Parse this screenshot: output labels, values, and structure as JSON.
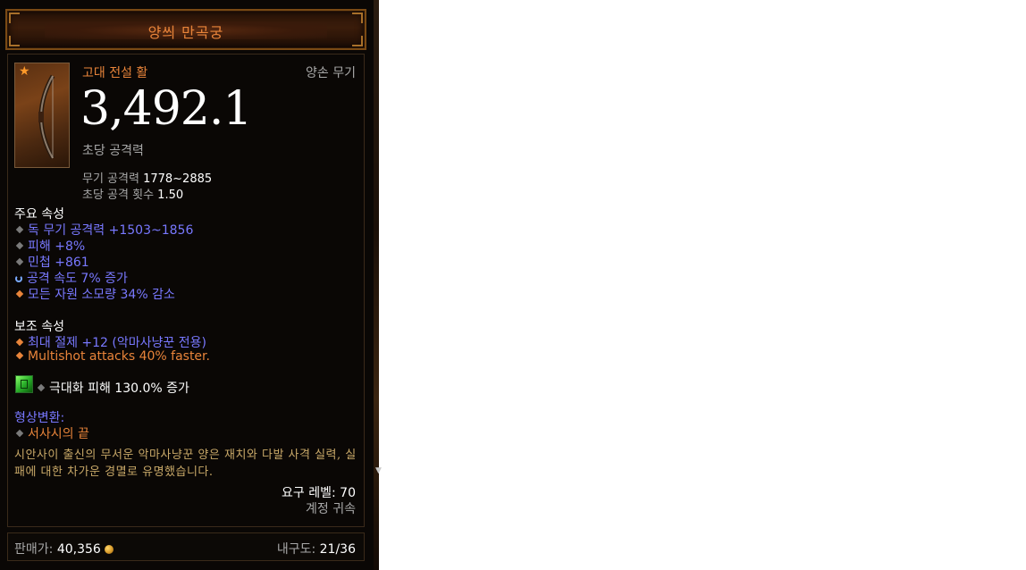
{
  "item": {
    "name": "양씌 만곡궁",
    "type": "고대 전설 활",
    "slot": "양손 무기",
    "dps": "3,492.1",
    "dps_label": "초당 공격력",
    "weapon_damage_label": "무기 공격력",
    "weapon_damage_value": "1778~2885",
    "attack_speed_label": "초당 공격 횟수",
    "attack_speed_value": "1.50"
  },
  "primary": {
    "title": "주요 속성",
    "attributes": [
      {
        "text": "독 무기 공격력 +1503~1856",
        "bullet": "grey"
      },
      {
        "text": "피해 +8%",
        "bullet": "grey"
      },
      {
        "text": "민첩 +861",
        "bullet": "grey"
      },
      {
        "text": "공격 속도 7% 증가",
        "bullet": "enchanted"
      },
      {
        "text": "모든 자원 소모량 34% 감소",
        "bullet": "orange"
      }
    ]
  },
  "secondary": {
    "title": "보조 속성",
    "attributes": [
      {
        "text": "최대 절제 +12 (악마사냥꾼 전용)",
        "bullet": "orange"
      },
      {
        "text": "Multishot attacks 40% faster.",
        "bullet": "orange"
      }
    ]
  },
  "socket": {
    "gem_icon": "emerald-gem-icon",
    "text": "극대화 피해 130.0% 증가"
  },
  "transmog": {
    "title": "형상변환:",
    "value": "서사시의 끝"
  },
  "flavor_text": "시안사이 출신의 무서운 악마사냥꾼 양은 재치와 다발 사격 실력, 실패에 대한 차가운 경멸로 유명했습니다.",
  "requirements": {
    "level_label": "요구 레벨:",
    "level_value": "70",
    "binding": "계정 귀속"
  },
  "footer": {
    "sell_label": "판매가:",
    "sell_value": "40,356",
    "durability_label": "내구도:",
    "durability_value": "21/36"
  },
  "colors": {
    "legendary_orange": "#e8843a",
    "magic_blue": "#7878ff",
    "grey_text": "#a8a8a8",
    "flavor_gold": "#c8a868"
  }
}
